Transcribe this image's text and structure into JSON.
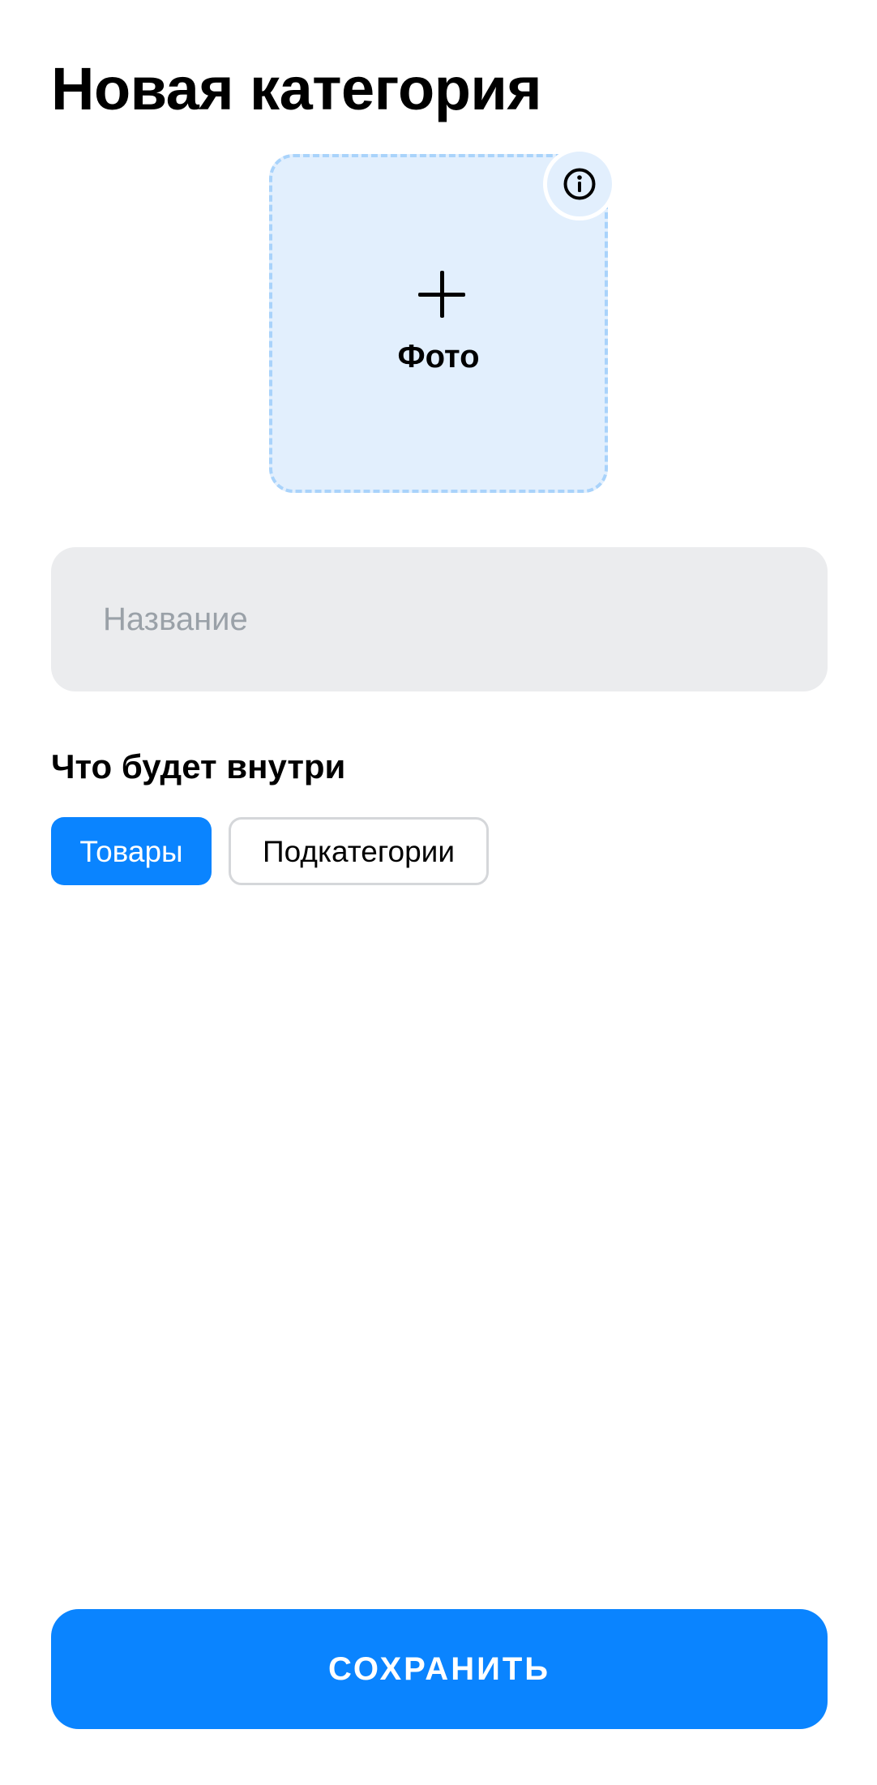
{
  "header": {
    "title": "Новая категория"
  },
  "photo_upload": {
    "label": "Фото",
    "add_icon": "plus-icon",
    "info_icon": "info-icon"
  },
  "name_field": {
    "value": "",
    "placeholder": "Название"
  },
  "content_type": {
    "title": "Что будет внутри",
    "options": [
      {
        "label": "Товары",
        "selected": true
      },
      {
        "label": "Подкатегории",
        "selected": false
      }
    ]
  },
  "footer": {
    "save_label": "СОХРАНИТЬ"
  },
  "colors": {
    "accent": "#0a84ff",
    "upload_background": "#e2effd",
    "upload_border": "#a9d3fb",
    "field_background": "#ebecee",
    "placeholder": "#9aa1a8",
    "chip_border": "#d5d7da"
  }
}
